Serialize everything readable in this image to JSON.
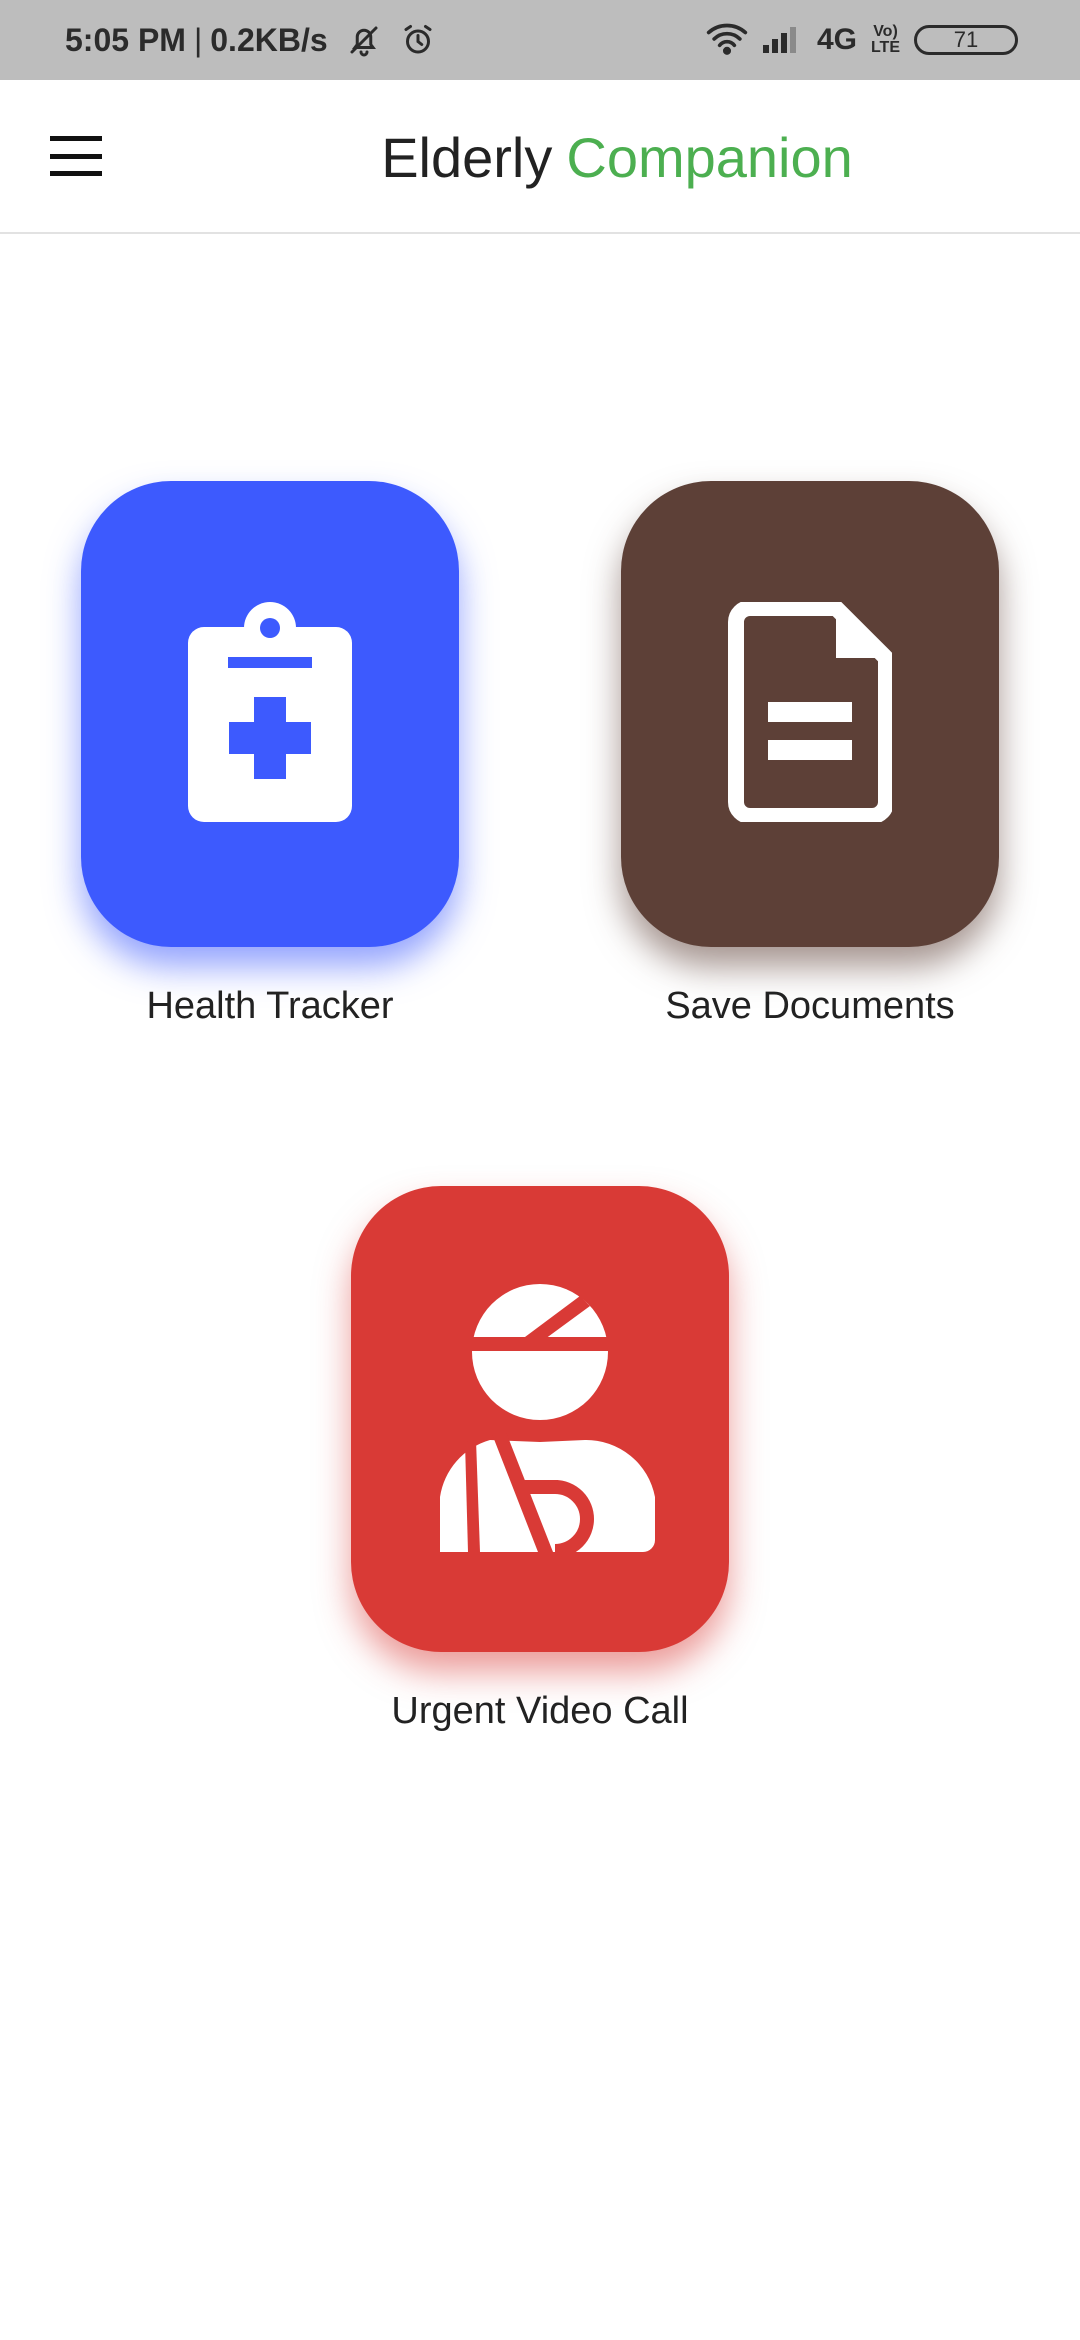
{
  "status_bar": {
    "time": "5:05 PM",
    "separator": "|",
    "speed": "0.2KB/s",
    "network": "4G",
    "volte_top": "Vo)",
    "volte_bottom": "LTE",
    "battery": "71",
    "icons": [
      "bell-off-icon",
      "alarm-icon",
      "wifi-icon",
      "signal-icon"
    ]
  },
  "app_bar": {
    "title_part1": "Elderly",
    "title_part2": "Companion",
    "accent_color": "#4caf50",
    "menu_icon": "hamburger-menu-icon"
  },
  "tiles": [
    {
      "label": "Health Tracker",
      "icon": "clipboard-medical-icon",
      "color": "#3d5afe"
    },
    {
      "label": "Save Documents",
      "icon": "document-icon",
      "color": "#5d4037"
    },
    {
      "label": "Urgent Video Call",
      "icon": "injured-person-icon",
      "color": "#d93a36"
    }
  ]
}
